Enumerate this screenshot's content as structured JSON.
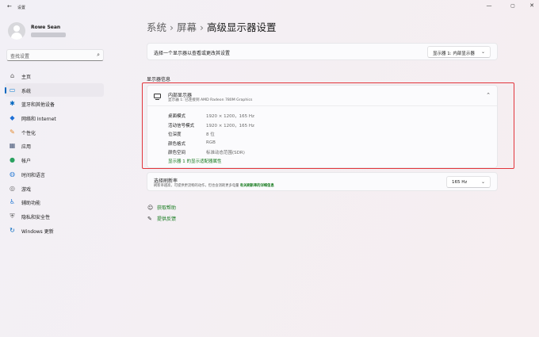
{
  "window": {
    "title": "设置",
    "back_icon": "arrow-left-icon",
    "minimize": "—",
    "maximize": "▢",
    "close": "✕"
  },
  "user": {
    "name": "Rowe Sean"
  },
  "search": {
    "placeholder": "查找设置",
    "icon": "search-icon"
  },
  "sidebar": {
    "items": [
      {
        "label": "主页",
        "icon": "home-icon",
        "color": "#555555",
        "active": false
      },
      {
        "label": "系统",
        "icon": "system-icon",
        "color": "#0a7bd1",
        "active": true
      },
      {
        "label": "蓝牙和其他设备",
        "icon": "bluetooth-icon",
        "color": "#0067c0",
        "active": false
      },
      {
        "label": "网络和 Internet",
        "icon": "wifi-icon",
        "color": "#1d6fd6",
        "active": false
      },
      {
        "label": "个性化",
        "icon": "brush-icon",
        "color": "#e38a2f",
        "active": false
      },
      {
        "label": "应用",
        "icon": "apps-icon",
        "color": "#4b5b7a",
        "active": false
      },
      {
        "label": "帐户",
        "icon": "account-icon",
        "color": "#2aa160",
        "active": false
      },
      {
        "label": "时间和语言",
        "icon": "globe-clock-icon",
        "color": "#2f7fd6",
        "active": false
      },
      {
        "label": "游戏",
        "icon": "gamepad-icon",
        "color": "#6a6a6a",
        "active": false
      },
      {
        "label": "辅助功能",
        "icon": "accessibility-icon",
        "color": "#2f7fd6",
        "active": false
      },
      {
        "label": "隐私和安全性",
        "icon": "shield-icon",
        "color": "#6a6a6a",
        "active": false
      },
      {
        "label": "Windows 更新",
        "icon": "update-icon",
        "color": "#0067c0",
        "active": false
      }
    ]
  },
  "breadcrumb": {
    "items": [
      "系统",
      "屏幕"
    ],
    "current": "高级显示器设置",
    "separator": "›"
  },
  "display_select": {
    "label": "选择一个显示器以查看或更改其设置",
    "value": "显示器 1: 内部显示器"
  },
  "display_info": {
    "section_title": "显示器信息",
    "name": "内部显示器",
    "subtitle": "显示器 1: 已连接到 AMD Radeon 780M Graphics",
    "specs": [
      {
        "label": "桌面模式",
        "value": "1920 × 1200，165 Hz"
      },
      {
        "label": "活动信号模式",
        "value": "1920 × 1200，165 Hz"
      },
      {
        "label": "位深度",
        "value": "8 位"
      },
      {
        "label": "颜色格式",
        "value": "RGB"
      },
      {
        "label": "颜色空间",
        "value": "标准动态范围(SDR)"
      }
    ],
    "adapter_link": "显示器 1 的显示适配器属性"
  },
  "refresh": {
    "title": "选择刷新率",
    "description": "刷新率越高，可提供更流畅的动作，但也会消耗更多电量",
    "more_link": "有关刷新率的详细信息",
    "value": "165 Hz"
  },
  "help": {
    "get_help": "获取帮助",
    "feedback": "提供反馈"
  },
  "colors": {
    "accent": "#0067c0",
    "link": "#167a1e",
    "highlight": "#e2353c"
  }
}
